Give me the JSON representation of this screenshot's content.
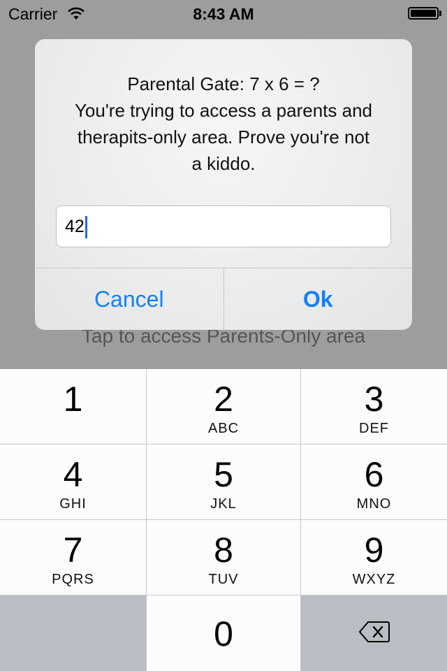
{
  "status_bar": {
    "carrier": "Carrier",
    "time": "8:43 AM"
  },
  "background": {
    "label": "Tap to access Parents-Only area"
  },
  "alert": {
    "message": "Parental Gate: 7 x 6 = ?\nYou're trying to access a parents and\ntherapits-only area. Prove you're not\na kiddo.",
    "input_value": "42",
    "cancel_label": "Cancel",
    "ok_label": "Ok",
    "accent_color": "#157ffb"
  },
  "keypad": {
    "keys": [
      {
        "digit": "1",
        "letters": ""
      },
      {
        "digit": "2",
        "letters": "ABC"
      },
      {
        "digit": "3",
        "letters": "DEF"
      },
      {
        "digit": "4",
        "letters": "GHI"
      },
      {
        "digit": "5",
        "letters": "JKL"
      },
      {
        "digit": "6",
        "letters": "MNO"
      },
      {
        "digit": "7",
        "letters": "PQRS"
      },
      {
        "digit": "8",
        "letters": "TUV"
      },
      {
        "digit": "9",
        "letters": "WXYZ"
      },
      {
        "digit": "0",
        "letters": ""
      }
    ],
    "delete_icon": "backspace-icon"
  }
}
